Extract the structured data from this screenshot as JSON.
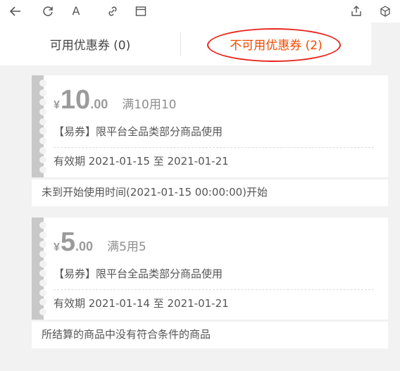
{
  "toolbar": {
    "icons": [
      "back-arrow-icon",
      "refresh-icon",
      "font-icon",
      "link-icon",
      "window-icon",
      "share-icon",
      "cube-icon"
    ],
    "font_glyph": "A"
  },
  "tabs": {
    "available": "可用优惠券 (0)",
    "unavailable": "不可用优惠券 (2)",
    "active": "unavailable",
    "active_color": "#f04a00"
  },
  "coupons": [
    {
      "currency": "¥",
      "amount_int": "10",
      "amount_dec": ".00",
      "condition": "满10用10",
      "scope": "【易券】限平台全品类部分商品使用",
      "validity": "有效期 2021-01-15 至 2021-01-21",
      "reason": "未到开始使用时间(2021-01-15 00:00:00)开始"
    },
    {
      "currency": "¥",
      "amount_int": "5",
      "amount_dec": ".00",
      "condition": "满5用5",
      "scope": "【易券】限平台全品类部分商品使用",
      "validity": "有效期 2021-01-14 至 2021-01-21",
      "reason": "所结算的商品中没有符合条件的商品"
    }
  ],
  "colors": {
    "accent": "#f04a00",
    "annotation": "#e8251b",
    "disabled_stripe": "#c8c8c8",
    "background": "#f2f2f2"
  }
}
